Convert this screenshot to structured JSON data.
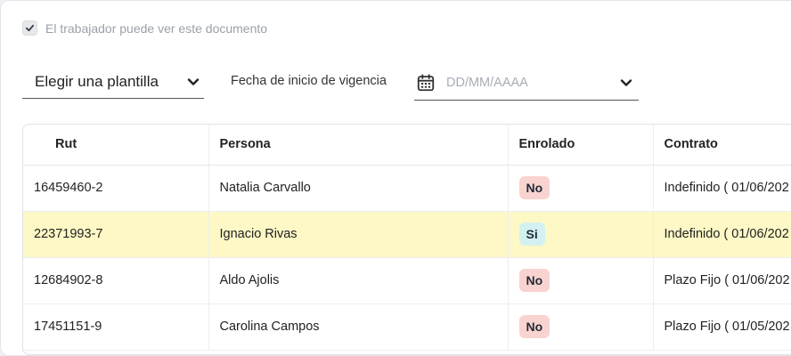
{
  "checkbox": {
    "label": "El trabajador puede ver este documento",
    "checked": true
  },
  "template_select": {
    "label": "Elegir una plantilla"
  },
  "date": {
    "label": "Fecha de inicio de vigencia",
    "placeholder": "DD/MM/AAAA"
  },
  "table": {
    "headers": {
      "rut": "Rut",
      "persona": "Persona",
      "enrolado": "Enrolado",
      "contrato": "Contrato"
    },
    "rows": [
      {
        "rut": "16459460-2",
        "persona": "Natalia Carvallo",
        "enrolado": "No",
        "contrato": "Indefinido ( 01/06/202"
      },
      {
        "rut": "22371993-7",
        "persona": "Ignacio Rivas",
        "enrolado": "Si",
        "contrato": "Indefinido ( 01/06/202"
      },
      {
        "rut": "12684902-8",
        "persona": "Aldo Ajolis",
        "enrolado": "No",
        "contrato": "Plazo Fijo ( 01/06/202"
      },
      {
        "rut": "17451151-9",
        "persona": "Carolina Campos",
        "enrolado": "No",
        "contrato": "Plazo Fijo ( 01/05/202"
      }
    ]
  },
  "colors": {
    "highlight_row": "#fdf8c5",
    "badge_no": "#f9d3cf",
    "badge_si": "#d4f1f1"
  },
  "icons": [
    "check-icon",
    "chevron-down-icon",
    "calendar-icon"
  ]
}
